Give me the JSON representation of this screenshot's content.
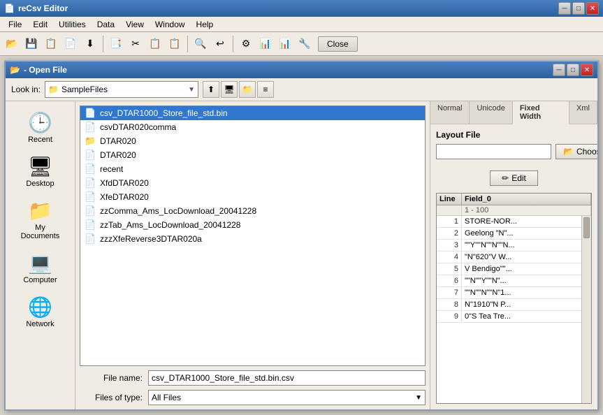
{
  "app": {
    "title": "reCsv Editor",
    "window_controls": [
      "minimize",
      "maximize",
      "close"
    ]
  },
  "menubar": {
    "items": [
      "File",
      "Edit",
      "Utilities",
      "Data",
      "View",
      "Window",
      "Help"
    ]
  },
  "toolbar": {
    "close_label": "Close"
  },
  "dialog": {
    "title": "- Open File",
    "look_in_label": "Look in:",
    "current_folder": "SampleFiles",
    "files": [
      {
        "name": "csv_DTAR1000_Store_file_std.bin",
        "type": "file"
      },
      {
        "name": "csvDTAR020comma",
        "type": "file"
      },
      {
        "name": "DTAR020",
        "type": "folder"
      },
      {
        "name": "DTAR020",
        "type": "file"
      },
      {
        "name": "recent",
        "type": "file"
      },
      {
        "name": "XfdDTAR020",
        "type": "file"
      },
      {
        "name": "XfeDTAR020",
        "type": "file"
      },
      {
        "name": "zzComma_Ams_LocDownload_20041228",
        "type": "file"
      },
      {
        "name": "zzTab_Ams_LocDownload_20041228",
        "type": "file"
      },
      {
        "name": "zzzXfeReverse3DTAR020a",
        "type": "file"
      }
    ],
    "filename_label": "File name:",
    "filename_value": "csv_DTAR1000_Store_file_std.bin.csv",
    "filetype_label": "Files of type:",
    "filetype_value": "All Files",
    "sidebar": [
      {
        "label": "Recent",
        "icon": "🕒"
      },
      {
        "label": "Desktop",
        "icon": "🖥"
      },
      {
        "label": "My Documents",
        "icon": "📁"
      },
      {
        "label": "Computer",
        "icon": "💻"
      },
      {
        "label": "Network",
        "icon": "🌐"
      }
    ]
  },
  "right_panel": {
    "tabs": [
      "Normal",
      "Unicode",
      "Fixed Width",
      "Xml"
    ],
    "active_tab": "Fixed Width",
    "layout_file_label": "Layout File",
    "choose_file_label": "Choose File",
    "edit_label": "Edit",
    "grid": {
      "col1_header": "Line",
      "col2_header": "Field_0",
      "col2_sub": "1 - 100",
      "rows": [
        {
          "line": "1",
          "value": "STORE-NOR..."
        },
        {
          "line": "2",
          "value": "Geelong \"N\"..."
        },
        {
          "line": "3",
          "value": "\"\"Y\"\"N\"\"N\"\"N..."
        },
        {
          "line": "4",
          "value": "\"N\"620\"V W..."
        },
        {
          "line": "5",
          "value": "V Bendigo\"\"..."
        },
        {
          "line": "6",
          "value": "\"\"N\"\"Y\"\"N\"..."
        },
        {
          "line": "7",
          "value": "\"\"N\"\"N\"\"N\"1..."
        },
        {
          "line": "8",
          "value": "N\"1910\"N P..."
        },
        {
          "line": "9",
          "value": "0\"S Tea Tre..."
        }
      ]
    }
  }
}
